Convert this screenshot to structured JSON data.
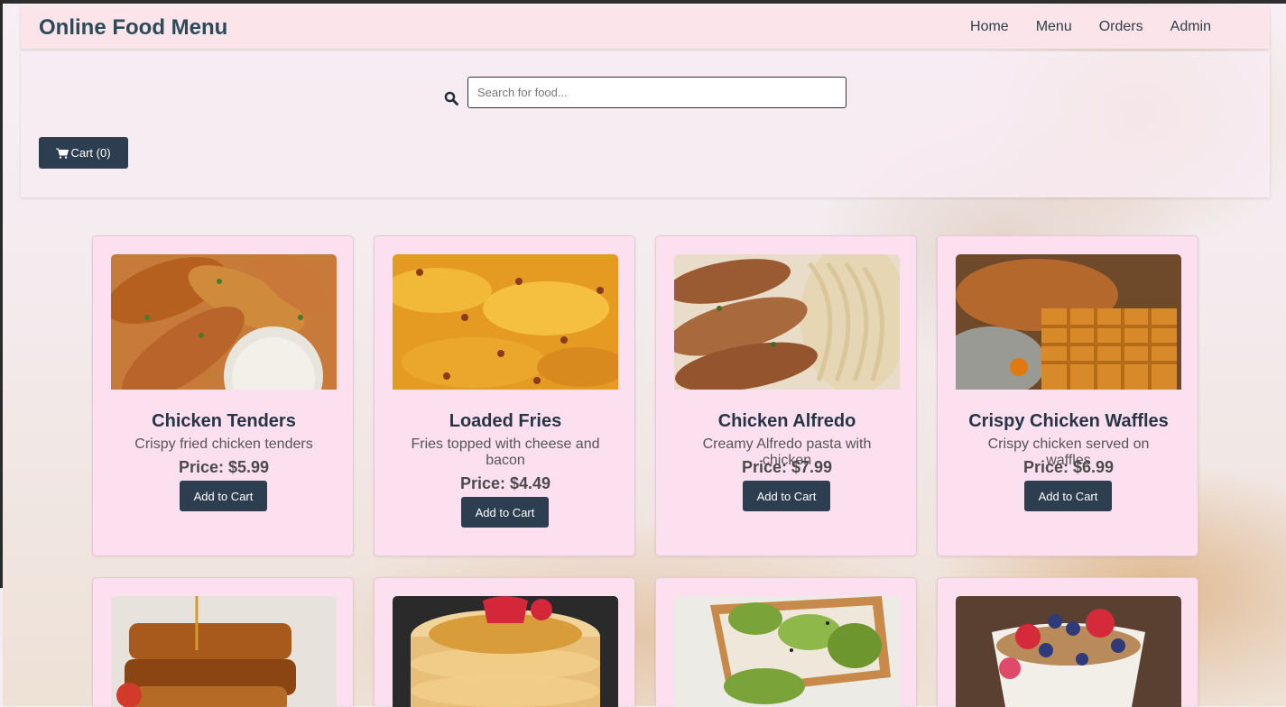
{
  "app": {
    "title": "Online Food Menu"
  },
  "nav": {
    "links": [
      "Home",
      "Menu",
      "Orders",
      "Admin"
    ]
  },
  "search": {
    "placeholder": "Search for food..."
  },
  "cart": {
    "label": "Cart (0)"
  },
  "items": [
    {
      "name": "Chicken Tenders",
      "description": "Crispy fried chicken tenders",
      "price": "Price: $5.99",
      "button": "Add to Cart"
    },
    {
      "name": "Loaded Fries",
      "description": "Fries topped with cheese and bacon",
      "price": "Price: $4.49",
      "button": "Add to Cart"
    },
    {
      "name": "Chicken Alfredo",
      "description": "Creamy Alfredo pasta with chicken",
      "price": "Price: $7.99",
      "button": "Add to Cart"
    },
    {
      "name": "Crispy Chicken Waffles",
      "description": "Crispy chicken served on waffles",
      "price": "Price: $6.99",
      "button": "Add to Cart"
    }
  ],
  "colors": {
    "navbar": "#fbe4ea",
    "card": "#fde0f0",
    "button": "#2d3e50",
    "brand": "#2c4a57"
  }
}
